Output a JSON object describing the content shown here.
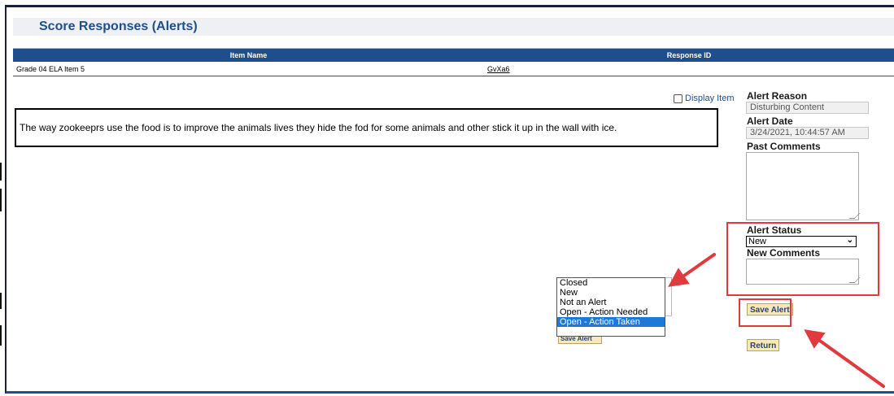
{
  "page": {
    "title": "Score Responses (Alerts)"
  },
  "table": {
    "headers": [
      "Item Name",
      "Response ID"
    ],
    "rows": [
      {
        "item_name": "Grade 04 ELA Item 5",
        "response_id": "GvXa6"
      }
    ]
  },
  "display_item": {
    "label": "Display Item",
    "checked": false
  },
  "response": {
    "text": "The way zookeeprs use the food is to improve the animals lives they hide the fod for some animals and other stick it up in the wall with ice."
  },
  "alert_panel": {
    "reason_label": "Alert Reason",
    "reason_value": "Disturbing Content",
    "date_label": "Alert Date",
    "date_value": "3/24/2021, 10:44:57 AM",
    "past_comments_label": "Past Comments",
    "status_label": "Alert Status",
    "status_value": "New",
    "new_comments_label": "New Comments",
    "save_label": "Save Alert",
    "return_label": "Return"
  },
  "status_dropdown": {
    "options": [
      "Closed",
      "New",
      "Not an Alert",
      "Open - Action Needed",
      "Open - Action Taken"
    ],
    "highlighted": "Open - Action Taken",
    "partial_button_label": "Save Alert"
  },
  "annotation_colors": {
    "highlight": "#e0393e",
    "accent": "#1f4e8c",
    "button_bg": "#f7e9b8"
  }
}
